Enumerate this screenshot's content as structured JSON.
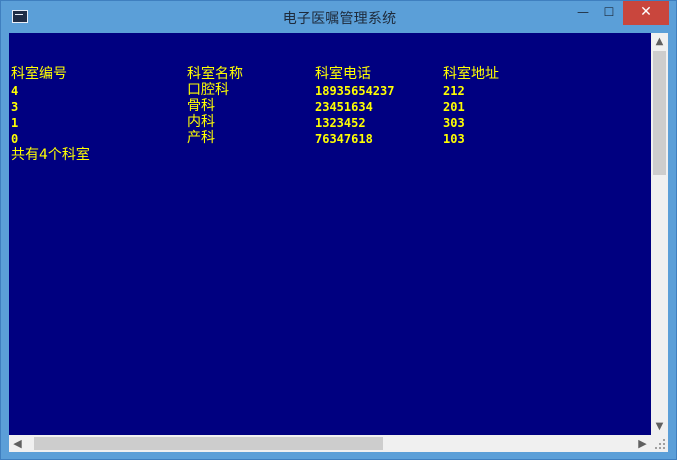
{
  "window": {
    "title": "电子医嘱管理系统",
    "minimize_glyph": "—",
    "maximize_glyph": "☐",
    "close_glyph": "✕",
    "close_color": "#c9463d"
  },
  "console": {
    "background": "#000080",
    "text_color": "#ffff00",
    "headers": [
      "科室编号",
      "科室名称",
      "科室电话",
      "科室地址"
    ],
    "rows": [
      [
        "4",
        "口腔科",
        "18935654237",
        "212"
      ],
      [
        "3",
        "骨科",
        "23451634",
        "201"
      ],
      [
        "1",
        "内科",
        "1323452",
        "303"
      ],
      [
        "0",
        "产科",
        "76347618",
        "103"
      ]
    ],
    "summary": "共有4个科室"
  },
  "scrollbars": {
    "up_glyph": "▲",
    "down_glyph": "▼",
    "left_glyph": "◀",
    "right_glyph": "▶"
  }
}
